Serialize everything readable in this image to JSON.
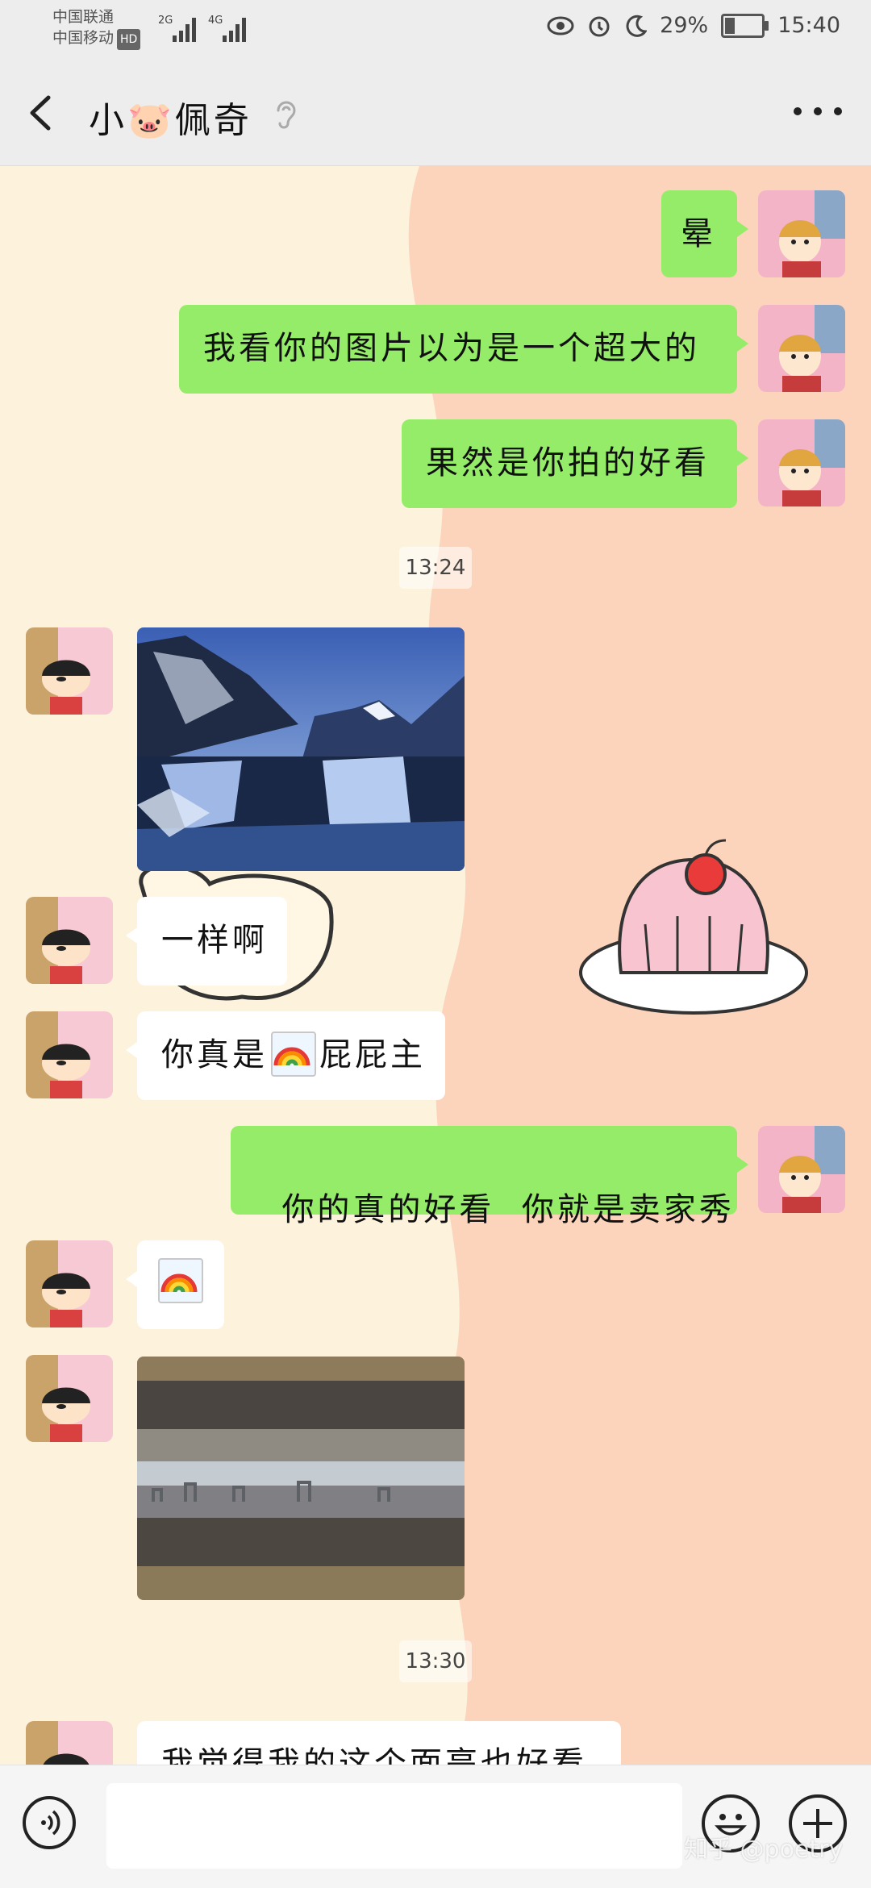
{
  "status_bar": {
    "carrier_1": "中国联通",
    "carrier_2": "中国移动",
    "hd": "HD",
    "sig1": "2G",
    "sig2": "4G",
    "battery": "29%",
    "time": "15:40"
  },
  "header": {
    "title": "小🐷佩奇",
    "more": "more-icon"
  },
  "messages": [
    {
      "side": "right",
      "text": "晕"
    },
    {
      "side": "right",
      "text": "我看你的图片以为是一个超大的"
    },
    {
      "side": "right",
      "text": "果然是你拍的好看"
    },
    {
      "type": "time",
      "text": "13:24"
    },
    {
      "side": "left",
      "type": "image",
      "subject": "snowy mountain waterfall"
    },
    {
      "side": "left",
      "text": "一样啊"
    },
    {
      "side": "left",
      "text_before": "你真是",
      "emoji": "rainbow",
      "text_after": "屁屁主"
    },
    {
      "side": "right",
      "text": "你的真的好看  你就是卖家秀"
    },
    {
      "side": "left",
      "emoji": "rainbow"
    },
    {
      "side": "left",
      "type": "image",
      "subject": "mirrored city panorama"
    },
    {
      "type": "time",
      "text": "13:30"
    },
    {
      "side": "left",
      "text": "我觉得我的这个面亮也好看"
    }
  ],
  "watermark": "知乎 @poetry",
  "icons": {
    "back": "back-arrow-icon",
    "ear": "ear-icon",
    "voice": "voice-icon",
    "emoji": "emoji-icon",
    "plus": "plus-icon"
  },
  "colors": {
    "sent_bubble": "#95ec69",
    "received_bubble": "#ffffff",
    "bar_background": "#ededed"
  }
}
